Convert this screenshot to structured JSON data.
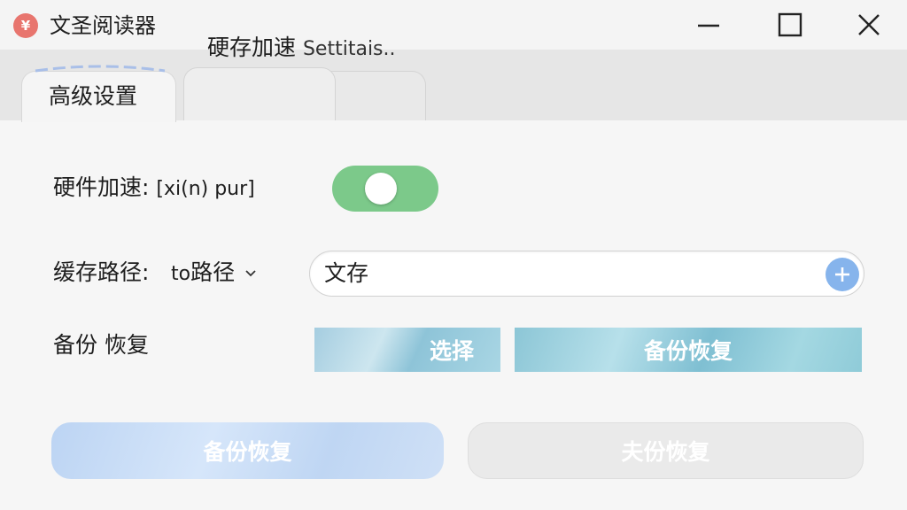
{
  "window": {
    "title": "文圣阅读器",
    "app_icon_glyph": "¥",
    "accent_color": "#e8756e"
  },
  "tabs": [
    {
      "label": "高级设置",
      "active": true
    },
    {
      "label_cjk": "硬存加速",
      "label_latin": "Settitais..",
      "active": false
    }
  ],
  "settings": {
    "hardware_accel": {
      "label_cjk": "硬件加速:",
      "label_latin": "[xi(n) pur]",
      "enabled": true,
      "toggle_color": "#7cc98a"
    },
    "cache_path": {
      "label_cjk": "缓存路径:",
      "dropdown_prefix": "to",
      "dropdown_value": "路径",
      "dropdown_icon": "chevron-down-icon",
      "input_value": "文存",
      "add_icon": "plus-icon"
    },
    "backup_restore": {
      "label": "备份 恢复",
      "select_button": "选择",
      "backup_restore_button": "备份恢复"
    }
  },
  "footer": {
    "left_button": "备份恢复",
    "right_button": "夫份恢复"
  }
}
